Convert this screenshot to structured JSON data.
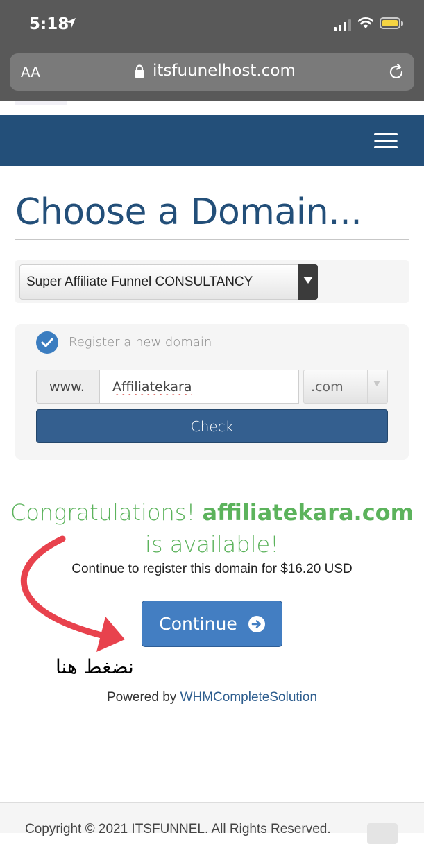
{
  "status_bar": {
    "time": "5:18"
  },
  "browser": {
    "text_size_control": "AA",
    "url": "itsfuunelhost.com"
  },
  "page": {
    "title": "Choose a Domain..."
  },
  "product_select": {
    "selected": "Super Affiliate Funnel CONSULTANCY"
  },
  "domain_form": {
    "register_option_label": "Register a new domain",
    "prefix": "www.",
    "sld_value": "Affiliatekara",
    "tld_selected": ".com",
    "check_button": "Check"
  },
  "result": {
    "congrats_prefix": "Congratulations!",
    "domain": "affiliatekara.com",
    "congrats_suffix": "is available!",
    "price_text": "Continue to register this domain for $16.20 USD",
    "continue_button": "Continue"
  },
  "annotation": {
    "text": "نضغط هنا",
    "color": "#e8424d"
  },
  "powered_by": {
    "prefix": "Powered by",
    "link": "WHMCompleteSolution"
  },
  "footer": {
    "copyright": "Copyright © 2021 ITSFUNNEL. All Rights Reserved."
  },
  "colors": {
    "brand_navy": "#234f79",
    "success_green": "#5cb35c",
    "button_blue": "#437ec2",
    "check_button": "#345f8f"
  }
}
